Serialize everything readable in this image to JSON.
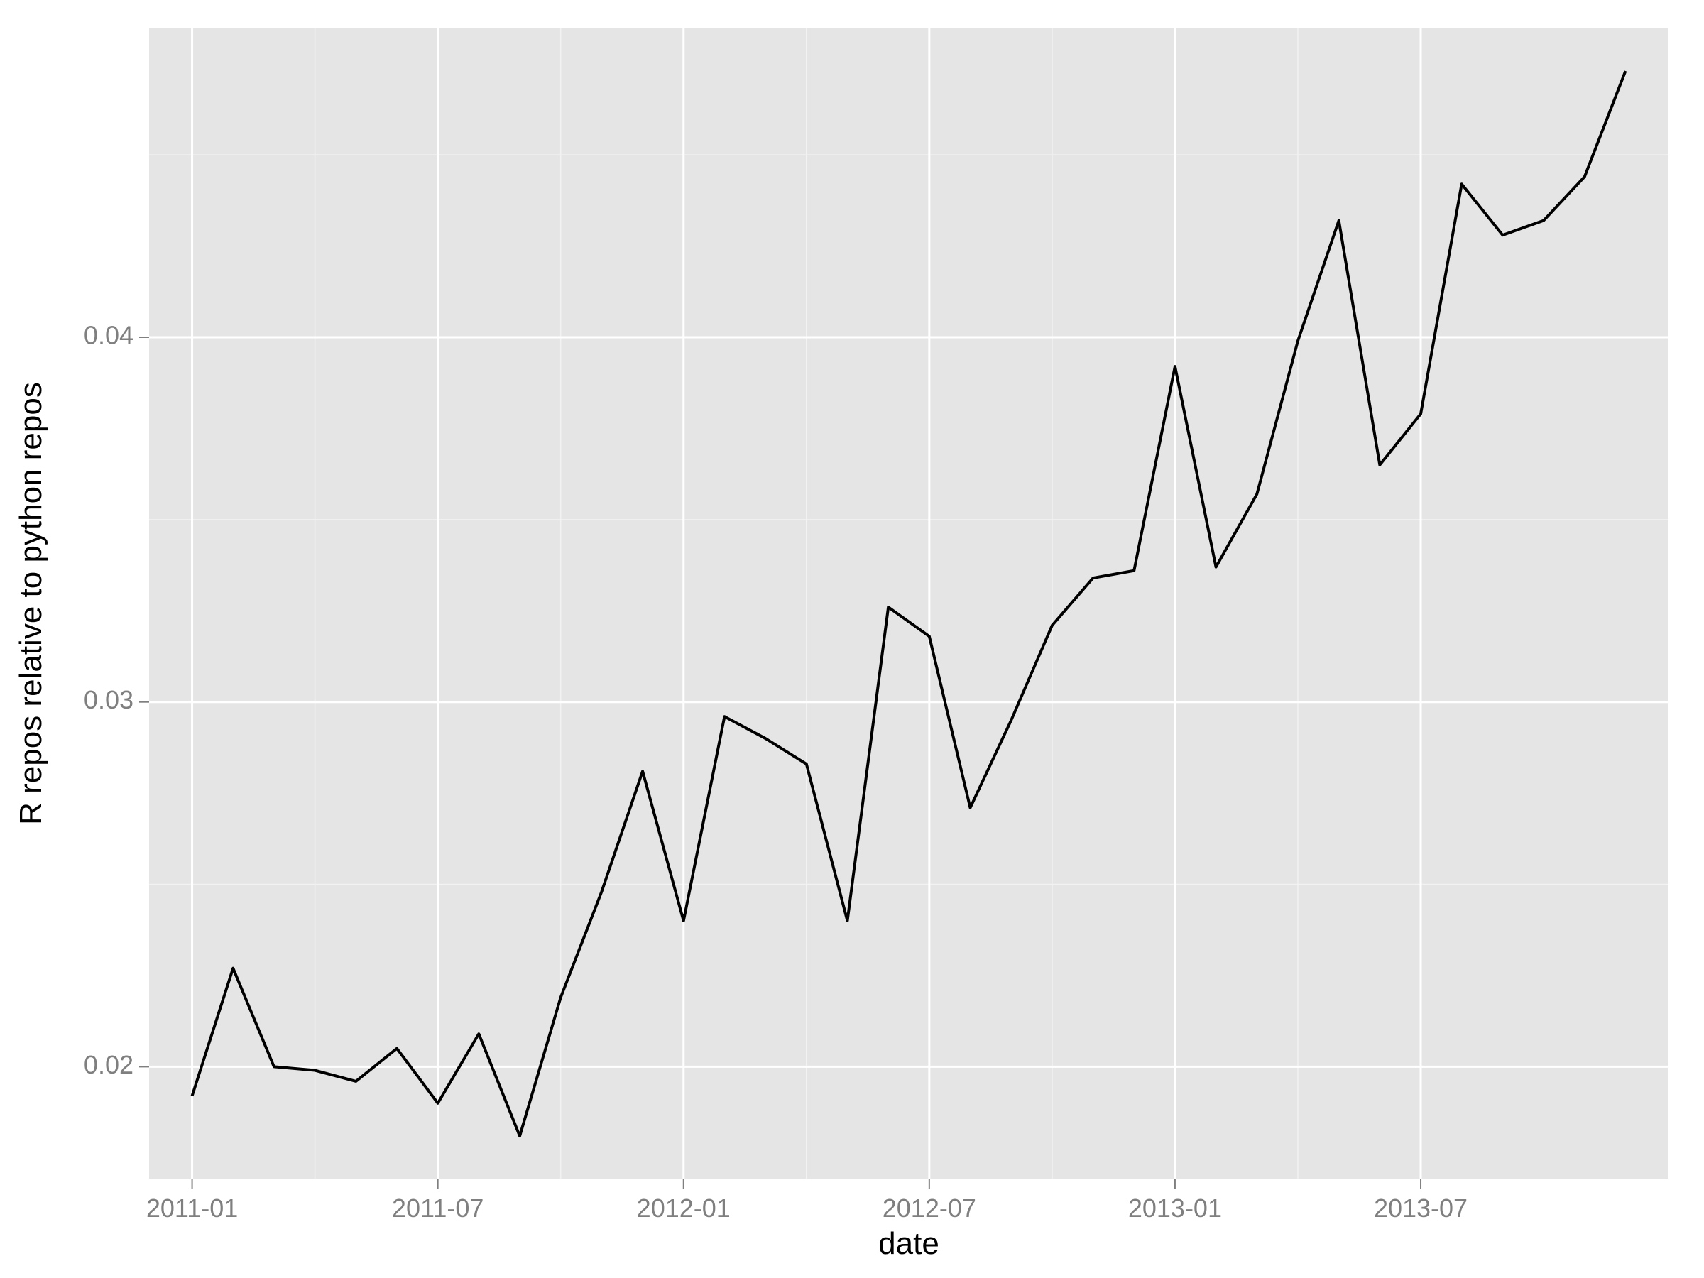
{
  "chart_data": {
    "type": "line",
    "xlabel": "date",
    "ylabel": "R repos relative to python repos",
    "title": "",
    "ylim": [
      0.017,
      0.048
    ],
    "y_ticks": [
      0.02,
      0.03,
      0.04
    ],
    "x_ticks": [
      "2011-01",
      "2011-07",
      "2012-01",
      "2012-07",
      "2013-01",
      "2013-07"
    ],
    "categories": [
      "2011-01",
      "2011-02",
      "2011-03",
      "2011-04",
      "2011-05",
      "2011-06",
      "2011-07",
      "2011-08",
      "2011-09",
      "2011-10",
      "2011-11",
      "2011-12",
      "2012-01",
      "2012-02",
      "2012-03",
      "2012-04",
      "2012-05",
      "2012-06",
      "2012-07",
      "2012-08",
      "2012-09",
      "2012-10",
      "2012-11",
      "2012-12",
      "2013-01",
      "2013-02",
      "2013-03",
      "2013-04",
      "2013-05",
      "2013-06",
      "2013-07",
      "2013-08",
      "2013-09"
    ],
    "values": [
      0.0192,
      0.0227,
      0.02,
      0.0199,
      0.0196,
      0.0205,
      0.019,
      0.0209,
      0.0181,
      0.0219,
      0.0248,
      0.0281,
      0.024,
      0.0296,
      0.029,
      0.0283,
      0.024,
      0.0326,
      0.0318,
      0.0271,
      0.0295,
      0.0321,
      0.0334,
      0.0336,
      0.0392,
      0.0337,
      0.0357,
      0.0399,
      0.0432,
      0.0365,
      0.0379,
      0.0442,
      0.0428,
      0.0432,
      0.0444,
      0.0473
    ]
  }
}
